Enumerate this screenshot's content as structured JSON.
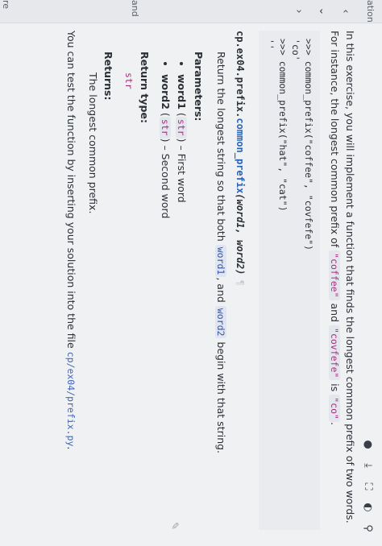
{
  "sidebar": {
    "words": [
      "ation",
      "and",
      "re"
    ]
  },
  "intro": {
    "text1": "In this exercise, you will implement a function that finds the longest common prefix of two words. For instance, the longest common prefix of ",
    "w1": "\"coffee\"",
    "and": " and ",
    "w2": "\"covfefe\"",
    "is": " is ",
    "res": "\"co\"",
    "end": "."
  },
  "doctest": ">>> common_prefix(\"coffee\", \"covfefe\")\n'co'\n>>> common_prefix(\"hat\", \"cat\")\n''",
  "signature": {
    "module": "cp.ex04.prefix.",
    "fn": "common_prefix",
    "args": "(word1, word2)",
    "anchor": "¶"
  },
  "description": {
    "pre": "Return the longest string so that both ",
    "a": "word1",
    "mid": ", and ",
    "b": "word2",
    "post": " begin with that string."
  },
  "params": {
    "heading": "Parameters:",
    "items": [
      {
        "name": "word1",
        "type": "str",
        "desc": " – First word"
      },
      {
        "name": "word2",
        "type": "str",
        "desc": " – Second word"
      }
    ]
  },
  "return_type": {
    "heading": "Return type:",
    "value": "str"
  },
  "returns": {
    "heading": "Returns:",
    "value": "The longest common prefix."
  },
  "closing": {
    "text": "You can test the function by inserting your solution into the file ",
    "file": "cp/ex04/prefix.py",
    "end": "."
  }
}
